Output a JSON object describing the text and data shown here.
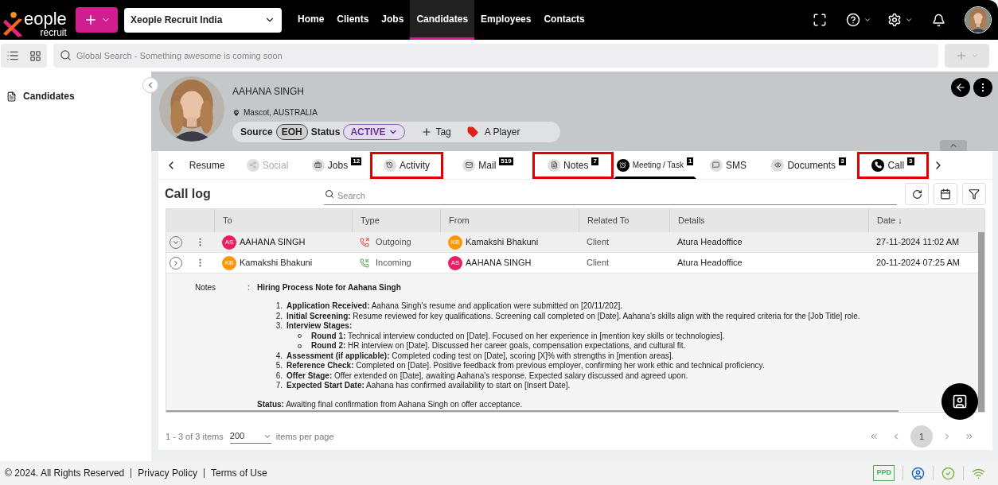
{
  "logo": {
    "text": "eople",
    "sub": "recruit"
  },
  "company_select": {
    "value": "Xeople Recruit India"
  },
  "nav": [
    {
      "label": "Home",
      "selected": false
    },
    {
      "label": "Clients",
      "selected": false
    },
    {
      "label": "Jobs",
      "selected": false
    },
    {
      "label": "Candidates",
      "selected": true
    },
    {
      "label": "Employees",
      "selected": false
    },
    {
      "label": "Contacts",
      "selected": false
    }
  ],
  "search": {
    "placeholder": "Global Search - Something awesome is coming soon"
  },
  "sidebar": {
    "items": [
      {
        "label": "Candidates",
        "selected": false
      }
    ]
  },
  "candidate": {
    "name": "AAHANA SINGH",
    "location": "Mascot, AUSTRALIA",
    "source_label": "Source",
    "source": "EOH",
    "status_label": "Status",
    "status": "ACTIVE",
    "tag_button": "Tag",
    "tag": "A Player"
  },
  "tabs": [
    {
      "label": "Resume",
      "selected": false,
      "highlighted": false,
      "disabled": false
    },
    {
      "label": "Social",
      "selected": false,
      "highlighted": false,
      "disabled": true
    },
    {
      "label": "Jobs",
      "count": "12",
      "selected": false,
      "highlighted": false,
      "disabled": false
    },
    {
      "label": "Activity",
      "selected": false,
      "highlighted": true,
      "disabled": false
    },
    {
      "label": "Mail",
      "count": "519",
      "selected": false,
      "highlighted": false,
      "disabled": false
    },
    {
      "label": "Notes",
      "count": "7",
      "selected": false,
      "highlighted": true,
      "disabled": false
    },
    {
      "label": "Meeting / Task",
      "count": "1",
      "selected": true,
      "highlighted": false,
      "disabled": false
    },
    {
      "label": "SMS",
      "selected": false,
      "highlighted": false,
      "disabled": false
    },
    {
      "label": "Documents",
      "count": "3",
      "selected": false,
      "highlighted": false,
      "disabled": false
    },
    {
      "label": "Call",
      "count": "3",
      "selected": false,
      "highlighted": true,
      "disabled": false
    }
  ],
  "call_log": {
    "title": "Call log",
    "search_placeholder": "Search",
    "columns": [
      "To",
      "Type",
      "From",
      "Related To",
      "Details",
      "Date ↓"
    ],
    "rows": [
      {
        "expanded": true,
        "to": {
          "initials": "AS",
          "name": "AAHANA SINGH",
          "color": "#e91e63"
        },
        "type": {
          "kind": "outgoing",
          "label": "Outgoing"
        },
        "from": {
          "initials": "KB",
          "name": "Kamakshi Bhakuni",
          "color": "#ff9800"
        },
        "related_to": "Client",
        "details": "Atura Headoffice",
        "date": "27-11-2024 11:02 AM"
      },
      {
        "expanded": false,
        "to": {
          "initials": "KB",
          "name": "Kamakshi Bhakuni",
          "color": "#ff9800"
        },
        "type": {
          "kind": "incoming",
          "label": "Incoming"
        },
        "from": {
          "initials": "AS",
          "name": "AAHANA SINGH",
          "color": "#e91e63"
        },
        "related_to": "Client",
        "details": "Atura Headoffice",
        "date": "20-11-2024 07:25 AM"
      }
    ],
    "detail": {
      "label": "Notes",
      "separator": ":",
      "title": "Hiring Process Note for Aahana Singh",
      "items": [
        {
          "number": "1.",
          "text": "**Application Received:** Aahana Singh's resume and application were submitted on [20/11/202]."
        },
        {
          "number": "2.",
          "text": "**Initial Screening:** Resume reviewed for key qualifications. Screening call completed on [Date]. Aahana's skills align with the required criteria for the [Job Title] role."
        },
        {
          "number": "3.",
          "text": "**Interview Stages:**",
          "children": [
            {
              "text": "**Round 1:** Technical interview conducted on [Date]. Focused on her experience in [mention key skills or technologies]."
            },
            {
              "text": "**Round 2:** HR interview on [Date]. Discussed her career goals, compensation expectations, and cultural fit."
            }
          ]
        },
        {
          "number": "4.",
          "text": "**Assessment (if applicable):** Completed coding test on [Date], scoring [X]% with strengths in [mention areas]."
        },
        {
          "number": "5.",
          "text": "**Reference Check:** Completed on [Date]. Positive feedback from previous employer, confirming her work ethic and technical proficiency."
        },
        {
          "number": "6.",
          "text": "**Offer Stage:** Offer extended on [Date], awaiting Aahana's response. Expected salary discussed and agreed upon."
        },
        {
          "number": "7.",
          "text": "**Expected Start Date:** Aahana has confirmed availability to start on [Insert Date]."
        }
      ],
      "status": "**Status:** Awaiting final confirmation from Aahana Singh on offer acceptance."
    },
    "pager": {
      "summary": "1 - 3 of 3 items",
      "page_size": "200",
      "page_size_label": "items per page",
      "pages": [
        {
          "label": "1",
          "selected": true
        }
      ]
    }
  },
  "footer": {
    "copyright": "© 2024. All Rights Reserved",
    "links": [
      "Privacy Policy",
      "Terms of Use"
    ],
    "badge": "PPD"
  }
}
